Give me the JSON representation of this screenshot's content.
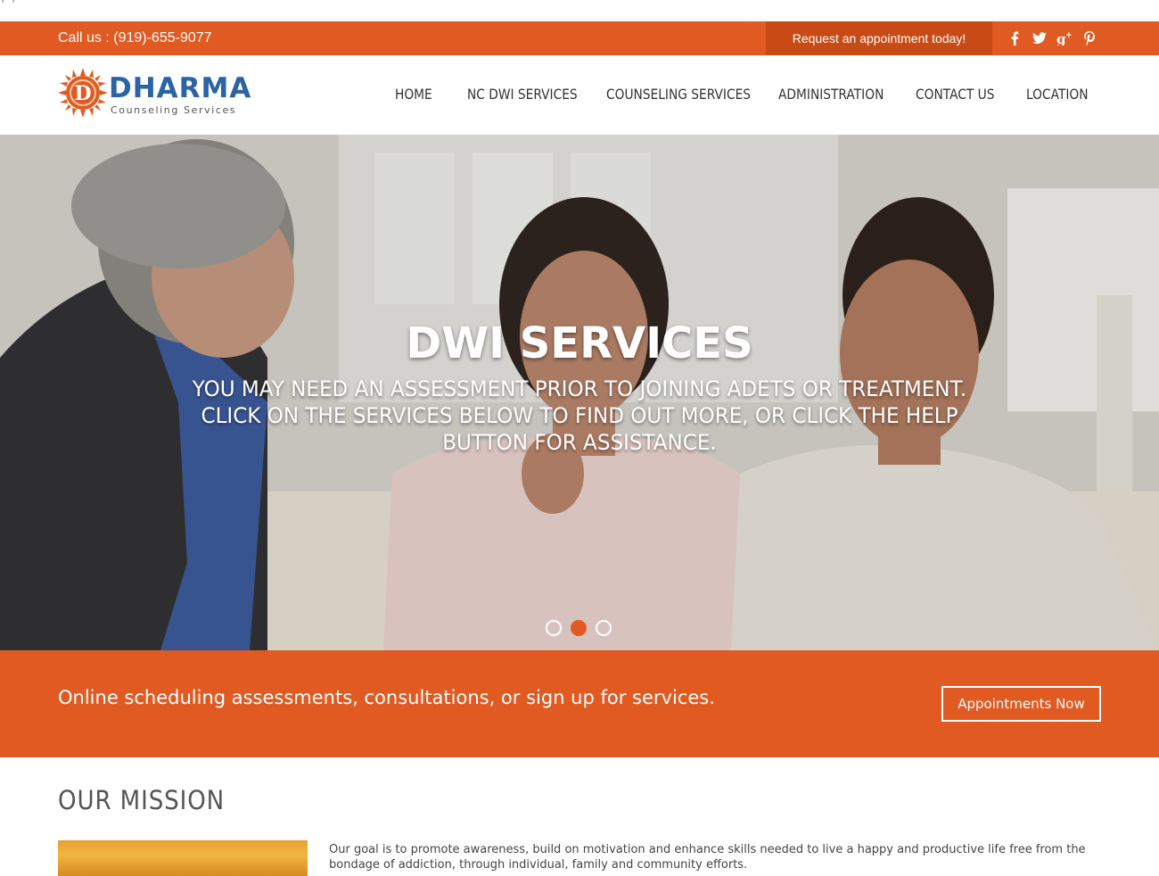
{
  "artifact": "' '",
  "topbar": {
    "call": "Call us : (919)-655-9077",
    "request": "Request an appointment today!",
    "socials": [
      {
        "name": "facebook-icon",
        "glyph": "f"
      },
      {
        "name": "twitter-icon",
        "glyph": "t"
      },
      {
        "name": "google-plus-icon",
        "glyph": "g+"
      },
      {
        "name": "pinterest-icon",
        "glyph": "p"
      }
    ]
  },
  "logo": {
    "brand": "DHARMA",
    "tagline": "Counseling Services",
    "letter": "D"
  },
  "nav": [
    {
      "key": "home",
      "label": "HOME"
    },
    {
      "key": "nc-dwi",
      "label": "NC DWI SERVICES"
    },
    {
      "key": "counseling",
      "label": "COUNSELING SERVICES"
    },
    {
      "key": "administration",
      "label": "ADMINISTRATION"
    },
    {
      "key": "contact",
      "label": "CONTACT US"
    },
    {
      "key": "location",
      "label": "LOCATION"
    }
  ],
  "hero": {
    "heading": "DWI SERVICES",
    "sub": "YOU MAY NEED AN ASSESSMENT PRIOR TO JOINING ADETS OR TREATMENT. CLICK ON THE SERVICES BELOW TO FIND OUT MORE, OR CLICK THE HELP BUTTON FOR ASSISTANCE.",
    "slides": 3,
    "active_slide": 2
  },
  "cta": {
    "text": "Online scheduling assessments, consultations, or sign up for services.",
    "button": "Appointments Now"
  },
  "mission": {
    "title": "OUR MISSION",
    "text": "Our goal is to promote awareness, build on motivation and enhance skills needed to live a happy and productive life free from the bondage of addiction, through individual, family and community efforts."
  },
  "colors": {
    "accent": "#e05a22",
    "accent_dark": "#c84a14",
    "brand_blue": "#2a63a6"
  }
}
